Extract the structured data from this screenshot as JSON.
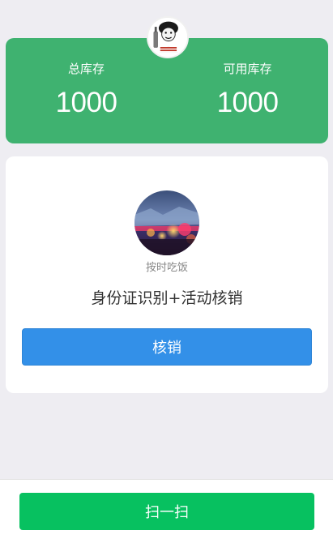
{
  "stats": {
    "total_label": "总库存",
    "total_value": "1000",
    "available_label": "可用库存",
    "available_value": "1000"
  },
  "event": {
    "name": "按时吃饭",
    "title": "身份证识别+活动核销",
    "verify_label": "核销"
  },
  "bottom": {
    "scan_label": "扫一扫"
  },
  "icons": {
    "top_avatar": "user-avatar-icon",
    "event_avatar": "event-image-icon"
  },
  "colors": {
    "stats_bg": "#3fb270",
    "verify_button": "#3390e8",
    "scan_button": "#07c160"
  }
}
